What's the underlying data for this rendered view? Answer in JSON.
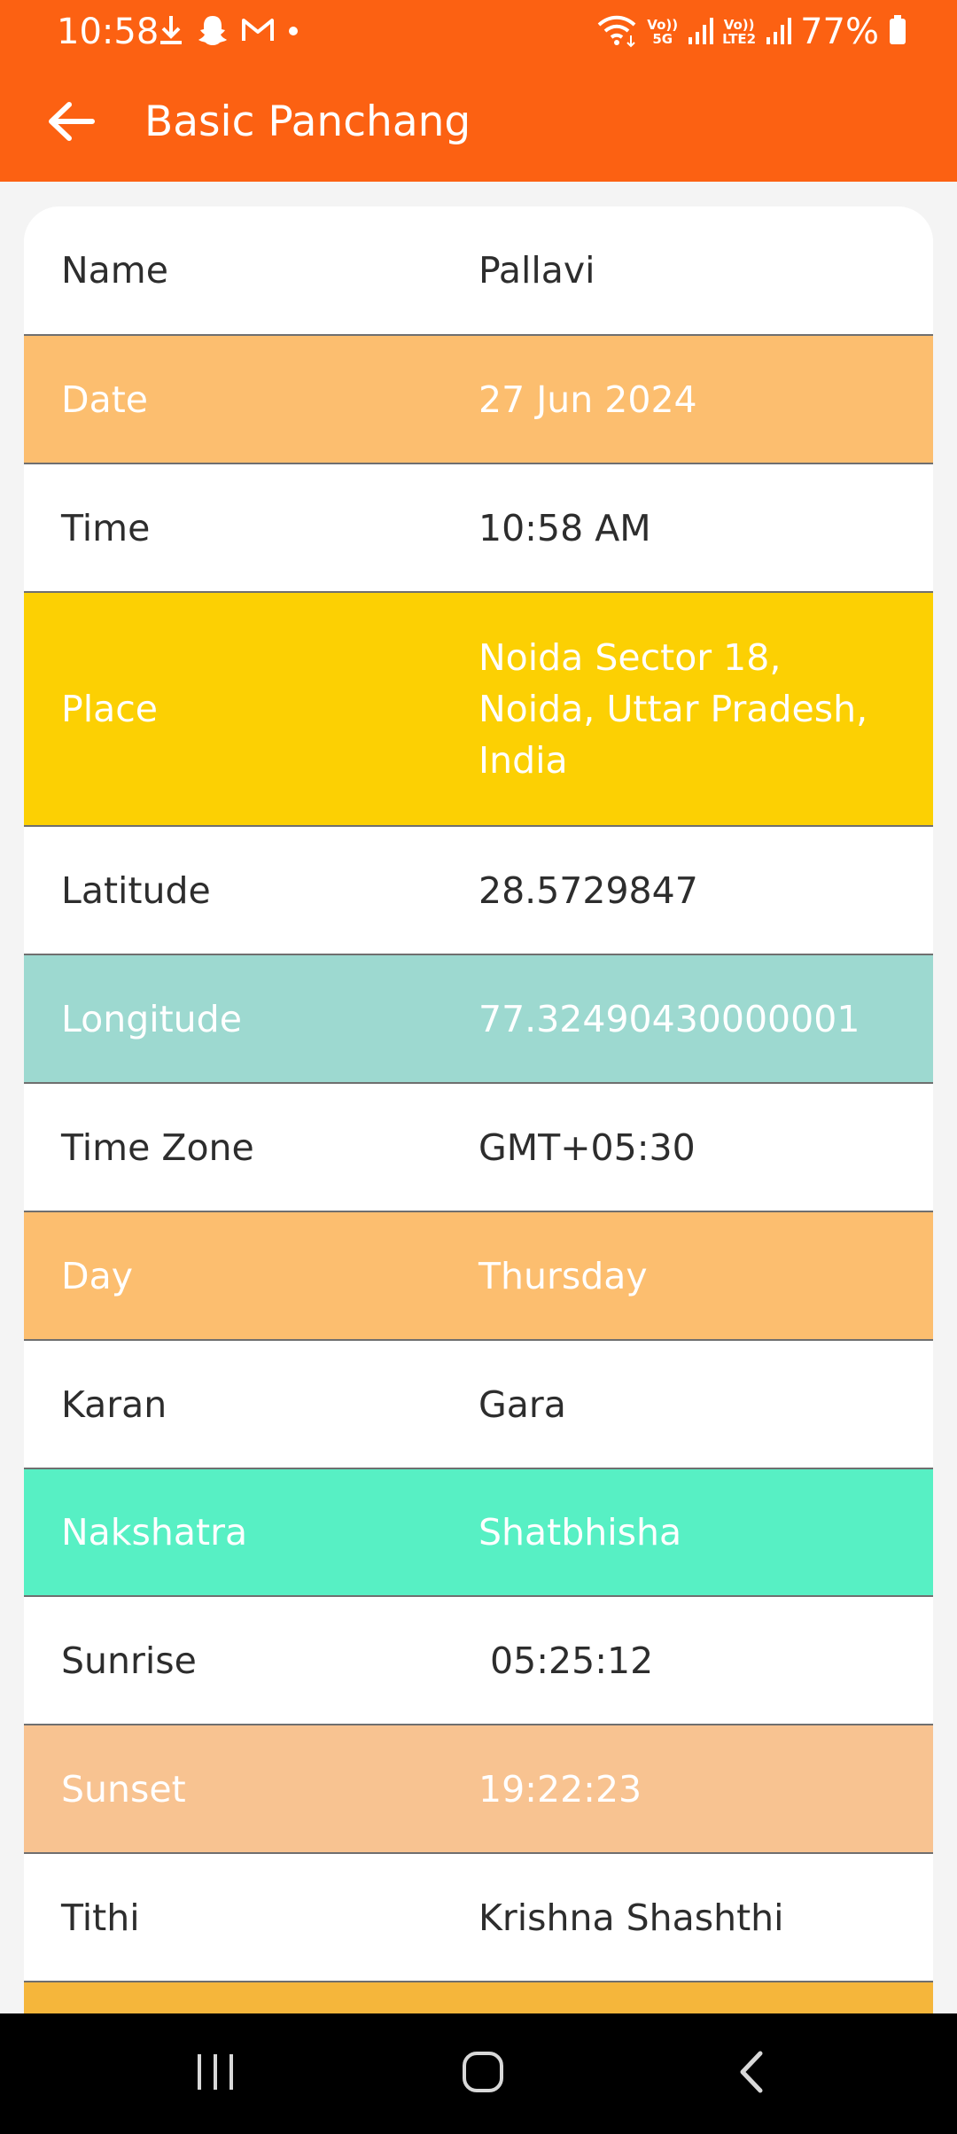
{
  "status_bar": {
    "time": "10:58",
    "battery": "77%",
    "background": "#fc6112",
    "icons": [
      "download-icon",
      "snapchat-icon",
      "gmail-icon",
      "dot-icon",
      "wifi-icon",
      "volte-5g-icon",
      "signal-icon",
      "volte-lte2-icon",
      "signal-icon",
      "battery-icon"
    ],
    "net_labels": [
      "Vo))",
      "5G",
      "Vo))",
      "LTE2"
    ]
  },
  "app_bar": {
    "title": "Basic Panchang",
    "back_icon": "arrow-left-icon",
    "background": "#fc6112"
  },
  "rows": [
    {
      "label": "Name",
      "value": "Pallavi",
      "color": "#ffffff",
      "text_color": "#2d2d2d"
    },
    {
      "label": "Date",
      "value": "27 Jun 2024",
      "color": "#fcbe6f",
      "text_color": "#ffffff"
    },
    {
      "label": "Time",
      "value": "10:58 AM",
      "color": "#ffffff",
      "text_color": "#2d2d2d"
    },
    {
      "label": "Place",
      "value": "Noida Sector 18, Noida, Uttar Pradesh, India",
      "color": "#fcd003",
      "text_color": "#ffffff"
    },
    {
      "label": "Latitude",
      "value": "28.5729847",
      "color": "#ffffff",
      "text_color": "#2d2d2d"
    },
    {
      "label": "Longitude",
      "value": "77.32490430000001",
      "color": "#9dd9d0",
      "text_color": "#ffffff"
    },
    {
      "label": "Time Zone",
      "value": "GMT+05:30",
      "color": "#ffffff",
      "text_color": "#2d2d2d"
    },
    {
      "label": "Day",
      "value": "Thursday",
      "color": "#fcbe6f",
      "text_color": "#ffffff"
    },
    {
      "label": "Karan",
      "value": "Gara",
      "color": "#ffffff",
      "text_color": "#2d2d2d"
    },
    {
      "label": "Nakshatra",
      "value": "Shatbhisha",
      "color": "#57f0c4",
      "text_color": "#ffffff"
    },
    {
      "label": "Sunrise",
      "value": " 05:25:12",
      "color": "#ffffff",
      "text_color": "#2d2d2d"
    },
    {
      "label": "Sunset",
      "value": "19:22:23",
      "color": "#f8c391",
      "text_color": "#ffffff"
    },
    {
      "label": "Tithi",
      "value": "Krishna Shashthi",
      "color": "#ffffff",
      "text_color": "#2d2d2d"
    },
    {
      "label": "",
      "value": "",
      "color": "#f5b63b",
      "text_color": "#ffffff"
    }
  ],
  "nav_bar": {
    "icons": [
      "recent-apps-icon",
      "home-icon",
      "back-icon"
    ]
  }
}
